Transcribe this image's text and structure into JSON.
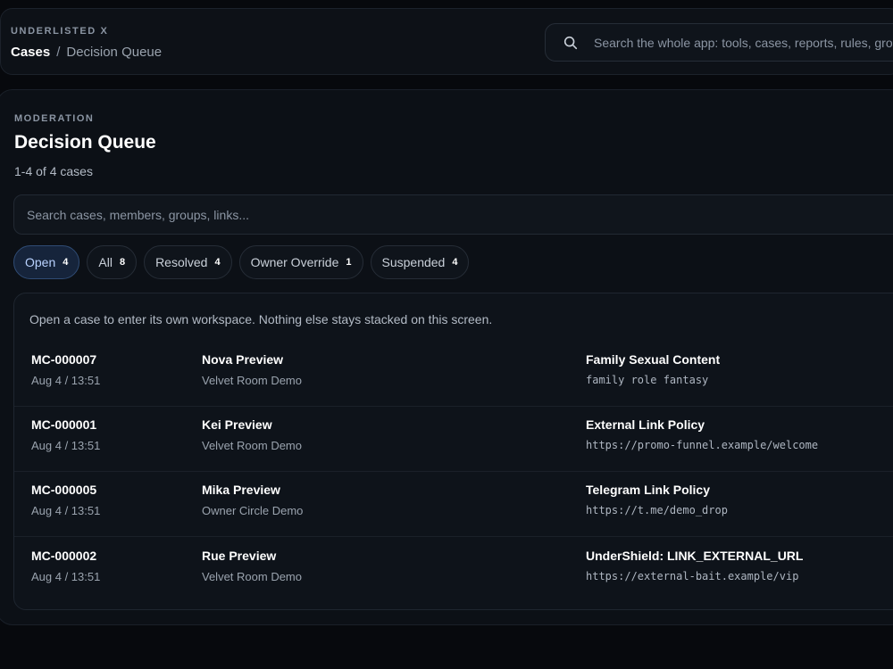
{
  "app": {
    "brand": "UNDERLISTED X"
  },
  "breadcrumb": {
    "section": "Cases",
    "separator": "/",
    "page": "Decision Queue"
  },
  "global_search": {
    "placeholder": "Search the whole app: tools, cases, reports, rules, groups",
    "icon": "search-icon"
  },
  "panel": {
    "eyebrow": "MODERATION",
    "title": "Decision Queue",
    "count": "1-4 of 4 cases",
    "search_placeholder": "Search cases, members, groups, links...",
    "tabs": [
      {
        "label": "Open",
        "count": "4",
        "active": true
      },
      {
        "label": "All",
        "count": "8",
        "active": false
      },
      {
        "label": "Resolved",
        "count": "4",
        "active": false
      },
      {
        "label": "Owner Override",
        "count": "1",
        "active": false
      },
      {
        "label": "Suspended",
        "count": "4",
        "active": false
      }
    ],
    "hint": "Open a case to enter its own workspace. Nothing else stays stacked on this screen."
  },
  "cases": [
    {
      "id": "MC-000007",
      "time": "Aug 4 / 13:51",
      "member": "Nova Preview",
      "group": "Velvet Room Demo",
      "rule": "Family Sexual Content",
      "evidence": "family role fantasy"
    },
    {
      "id": "MC-000001",
      "time": "Aug 4 / 13:51",
      "member": "Kei Preview",
      "group": "Velvet Room Demo",
      "rule": "External Link Policy",
      "evidence": "https://promo-funnel.example/welcome"
    },
    {
      "id": "MC-000005",
      "time": "Aug 4 / 13:51",
      "member": "Mika Preview",
      "group": "Owner Circle Demo",
      "rule": "Telegram Link Policy",
      "evidence": "https://t.me/demo_drop"
    },
    {
      "id": "MC-000002",
      "time": "Aug 4 / 13:51",
      "member": "Rue Preview",
      "group": "Velvet Room Demo",
      "rule": "UnderShield: LINK_EXTERNAL_URL",
      "evidence": "https://external-bait.example/vip"
    }
  ],
  "colors": {
    "background": "#07090d",
    "panel": "#0c1016",
    "active_tab": "#16243b",
    "active_tab_text": "#b9d2ff"
  }
}
